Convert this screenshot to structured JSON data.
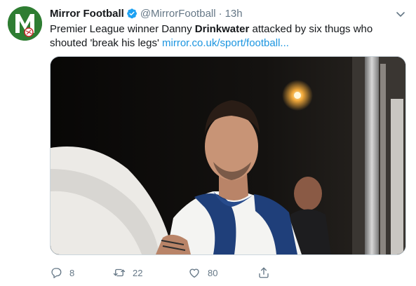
{
  "tweet": {
    "author": {
      "display_name": "Mirror Football",
      "handle": "@MirrorFootball",
      "verified": true,
      "avatar_icon": "mirror-football-logo-icon"
    },
    "separator": "·",
    "timestamp": "13h",
    "text": {
      "part1": "Premier League winner Danny ",
      "bold": "Drinkwater",
      "part2": " attacked by six thugs who shouted 'break his legs' ",
      "link": "mirror.co.uk/sport/football..."
    },
    "media": {
      "type": "photo"
    },
    "actions": {
      "reply_count": "8",
      "retweet_count": "22",
      "like_count": "80"
    }
  },
  "colors": {
    "link": "#1b95e0",
    "verified": "#1da1f2",
    "muted": "#657786",
    "avatar_bg": "#2e7d32"
  }
}
